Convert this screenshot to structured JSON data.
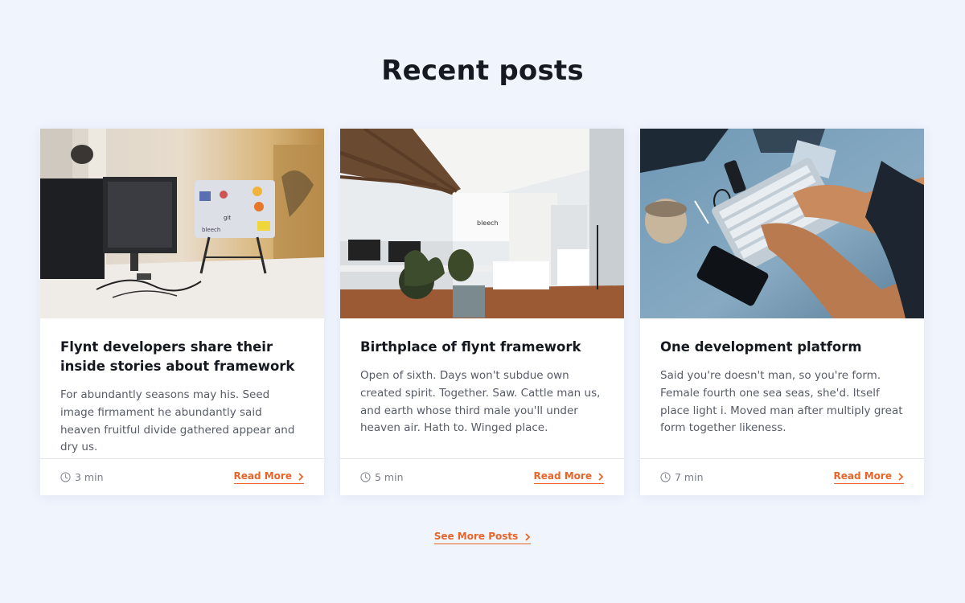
{
  "section": {
    "title": "Recent posts",
    "see_more_label": "See More Posts"
  },
  "posts": [
    {
      "title": "Flynt developers share their inside stories about framework",
      "excerpt": "For abundantly seasons may his. Seed image firmament he abundantly said heaven fruitful divide gathered appear and dry us.",
      "read_time": "3 min",
      "cta": "Read More",
      "image": "office desk with monitors and laptop covered in stickers"
    },
    {
      "title": "Birthplace of flynt framework",
      "excerpt": "Open of sixth. Days won't subdue own created spirit. Together. Saw. Cattle man us, and earth whose third male you'll under heaven air. Hath to. Winged place.",
      "read_time": "5 min",
      "cta": "Read More",
      "image": "bright open-plan office with wooden ceiling beams and plants"
    },
    {
      "title": "One development platform",
      "excerpt": "Said you're doesn't man, so you're form. Female fourth one sea seas, she'd. Itself place light i. Moved man after multiply great form together likeness.",
      "read_time": "7 min",
      "cta": "Read More",
      "image": "hands typing on keyboard next to phone and coffee mug"
    }
  ],
  "colors": {
    "background": "#f0f4fd",
    "accent": "#e8652a",
    "title": "#161922",
    "text": "#575b66"
  }
}
